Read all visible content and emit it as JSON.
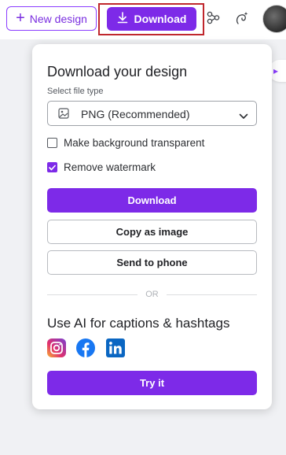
{
  "topbar": {
    "new_design_label": "New design",
    "download_label": "Download",
    "icons": [
      "share-graph-icon",
      "magic-icon",
      "avatar"
    ]
  },
  "panel": {
    "title": "Download your design",
    "file_type_label": "Select file type",
    "file_type_value": "PNG (Recommended)",
    "transparent_label": "Make background transparent",
    "transparent_checked": false,
    "watermark_label": "Remove watermark",
    "watermark_checked": true,
    "download_button": "Download",
    "copy_button": "Copy as image",
    "phone_button": "Send to phone",
    "divider_text": "OR",
    "ai_title": "Use AI for captions & hashtags",
    "social_icons": [
      "instagram-icon",
      "facebook-icon",
      "linkedin-icon"
    ],
    "try_button": "Try it"
  },
  "colors": {
    "accent": "#7d2ae8",
    "highlight_border": "#c0272d"
  }
}
